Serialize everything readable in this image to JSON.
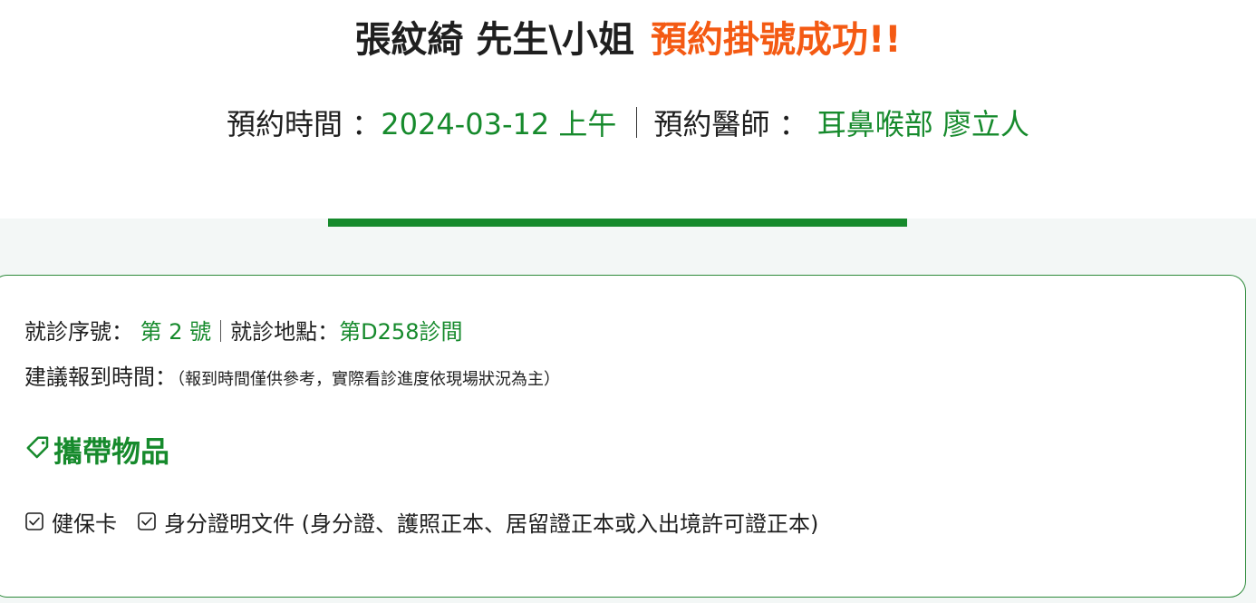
{
  "header": {
    "patient_name": "張紋綺 先生\\小姐",
    "success_text": "預約掛號成功!!",
    "time_label": "預約時間 ：",
    "time_value": "2024-03-12 上午",
    "doctor_label": "預約醫師 ：",
    "doctor_value": "耳鼻喉部 廖立人"
  },
  "details": {
    "seq_label": "就診序號：",
    "seq_value": "第 2 號",
    "location_label": "就診地點：",
    "location_value": "第D258診間",
    "checkin_label": "建議報到時間：",
    "checkin_note": "（報到時間僅供參考，實際看診進度依現場狀況為主）"
  },
  "bring_items": {
    "title": "攜帶物品",
    "items": [
      "健保卡",
      "身分證明文件 (身分證、護照正本、居留證正本或入出境許可證正本)"
    ]
  },
  "colors": {
    "accent_green": "#168a2c",
    "success_orange": "#f45a13",
    "band_bg": "#f3f7f6"
  },
  "icons": {
    "section": "tag-icon",
    "item": "checkbox-checked-icon"
  }
}
